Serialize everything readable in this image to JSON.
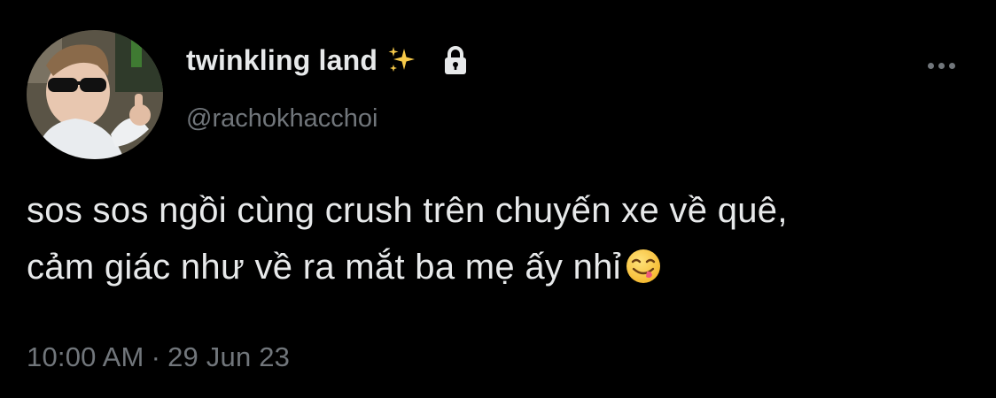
{
  "author": {
    "display_name": "twinkling land",
    "handle": "@rachokhacchoi",
    "name_badge_icon": "sparkles-icon",
    "protected_icon": "lock-icon",
    "avatar_icon": "avatar-photo"
  },
  "tweet": {
    "line1": "sos sos ngồi cùng crush trên chuyến xe về quê,",
    "line2": "cảm giác như về ra mắt ba mẹ ấy nhỉ",
    "emoji_icon": "face-savoring-food-icon"
  },
  "meta": {
    "time": "10:00 AM",
    "separator": "·",
    "date": "29 Jun 23"
  },
  "menu": {
    "more_icon": "more-options-icon"
  },
  "colors": {
    "background": "#000000",
    "primary_text": "#e7e9ea",
    "secondary_text": "#71767b",
    "sparkle": "#f6c94a"
  }
}
